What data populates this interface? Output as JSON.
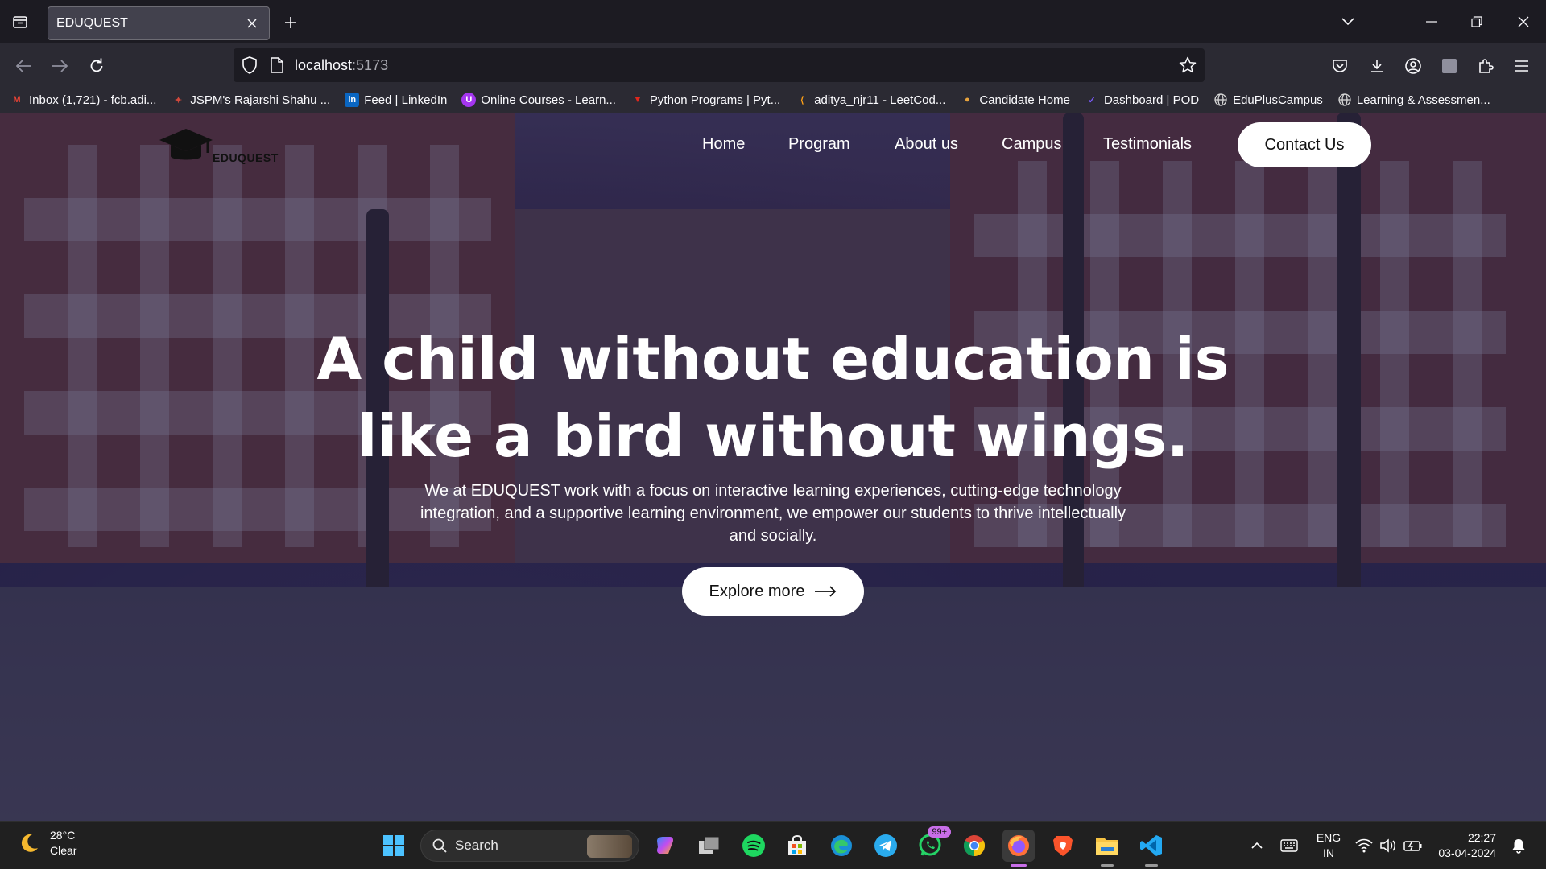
{
  "browser": {
    "tab_title": "EDUQUEST",
    "url_host": "localhost",
    "url_port": ":5173",
    "bookmarks": [
      {
        "label": "Inbox (1,721) - fcb.adi...",
        "icon": "gmail-icon",
        "color": "#ea4335"
      },
      {
        "label": "JSPM's Rajarshi Shahu ...",
        "icon": "college-icon",
        "color": "#d0483c"
      },
      {
        "label": "Feed | LinkedIn",
        "icon": "linkedin-icon",
        "color": "#0a66c2"
      },
      {
        "label": "Online Courses - Learn...",
        "icon": "udemy-icon",
        "color": "#a435f0"
      },
      {
        "label": "Python Programs | Pyt...",
        "icon": "geeks-icon",
        "color": "#e0271d"
      },
      {
        "label": "aditya_njr11 - LeetCod...",
        "icon": "leetcode-icon",
        "color": "#ffa116"
      },
      {
        "label": "Candidate Home",
        "icon": "candidate-icon",
        "color": "#e8a33d"
      },
      {
        "label": "Dashboard | POD",
        "icon": "pod-icon",
        "color": "#7b5cff"
      },
      {
        "label": "EduPlusCampus",
        "icon": "globe-icon",
        "color": "#d8d8d8"
      },
      {
        "label": "Learning & Assessmen...",
        "icon": "globe-icon",
        "color": "#d8d8d8"
      }
    ]
  },
  "site": {
    "logo_text": "EDUQUEST",
    "nav": [
      "Home",
      "Program",
      "About us",
      "Campus",
      "Testimonials"
    ],
    "contact_label": "Contact Us",
    "hero_title_line1": "A child without education is",
    "hero_title_line2": "like a bird without wings.",
    "hero_subtitle": "We at EDUQUEST work with a focus on interactive learning experiences, cutting-edge technology integration, and a supportive learning environment, we empower our students to thrive intellectually and socially.",
    "explore_label": "Explore more"
  },
  "taskbar": {
    "weather_temp": "28°C",
    "weather_cond": "Clear",
    "search_label": "Search",
    "whatsapp_badge": "99+",
    "lang_top": "ENG",
    "lang_bottom": "IN",
    "time": "22:27",
    "date": "03-04-2024"
  },
  "colors": {
    "accent_white": "#ffffff",
    "chrome_dark": "#1c1b22",
    "chrome_mid": "#2b2a33"
  }
}
